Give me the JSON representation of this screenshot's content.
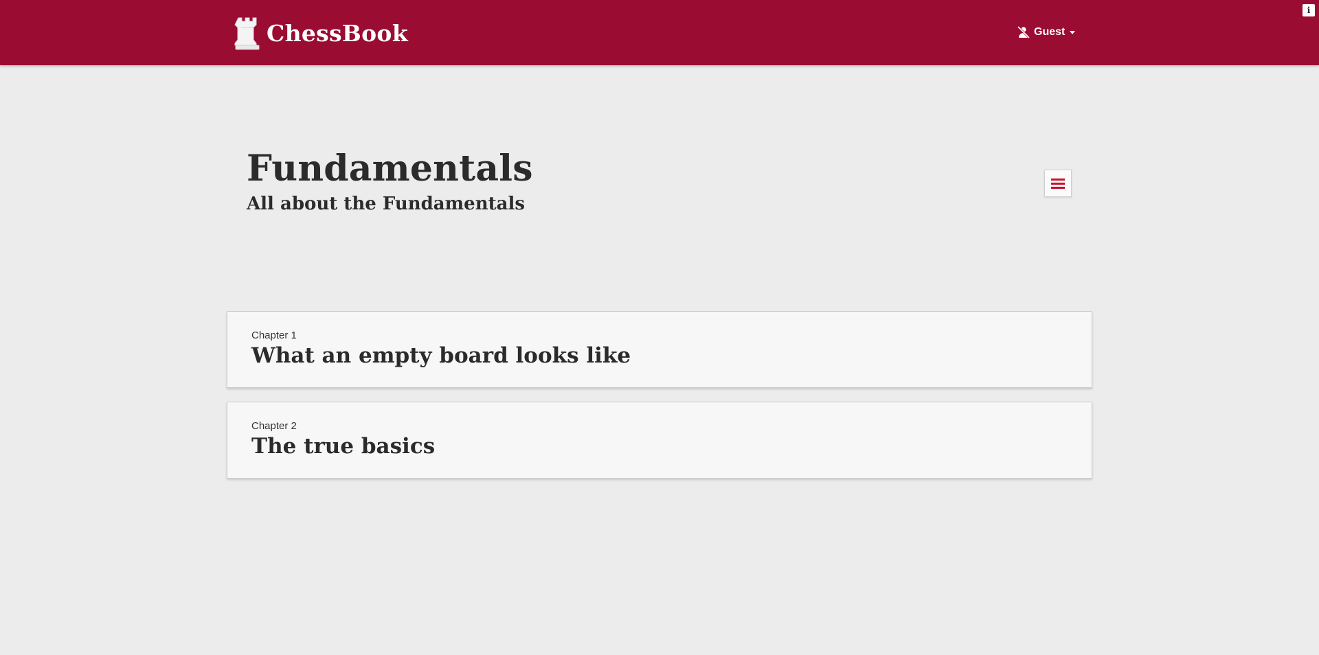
{
  "header": {
    "brand_name": "ChessBook",
    "brand_icon": "rook-icon",
    "user": {
      "label": "Guest",
      "icon": "user-slash-icon",
      "caret": "caret-down-icon"
    },
    "corner_badge": "i"
  },
  "main": {
    "title": "Fundamentals",
    "subtitle": "All about the Fundamentals",
    "menu_button_icon": "hamburger-icon"
  },
  "chapters": [
    {
      "number_label": "Chapter 1",
      "title": "What an empty board looks like"
    },
    {
      "number_label": "Chapter 2",
      "title": "The true basics"
    }
  ],
  "colors": {
    "header_bg": "#9b0c33",
    "page_bg": "#ececec",
    "card_bg": "#f7f7f7",
    "accent": "#c8102e"
  }
}
